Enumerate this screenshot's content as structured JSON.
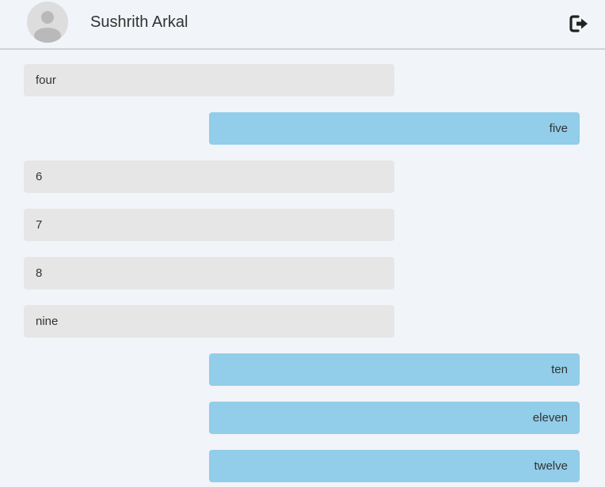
{
  "header": {
    "user_name": "Sushrith Arkal",
    "avatar_icon": "user-avatar-icon",
    "logout_icon": "sign-out-icon"
  },
  "colors": {
    "background": "#f1f4f8",
    "received_bubble": "#e6e6e6",
    "sent_bubble": "#92cdea",
    "text": "#333333"
  },
  "messages": [
    {
      "text": "four",
      "side": "received"
    },
    {
      "text": "five",
      "side": "sent"
    },
    {
      "text": "6",
      "side": "received"
    },
    {
      "text": "7",
      "side": "received"
    },
    {
      "text": "8",
      "side": "received"
    },
    {
      "text": "nine",
      "side": "received"
    },
    {
      "text": "ten",
      "side": "sent"
    },
    {
      "text": "eleven",
      "side": "sent"
    },
    {
      "text": "twelve",
      "side": "sent"
    }
  ]
}
